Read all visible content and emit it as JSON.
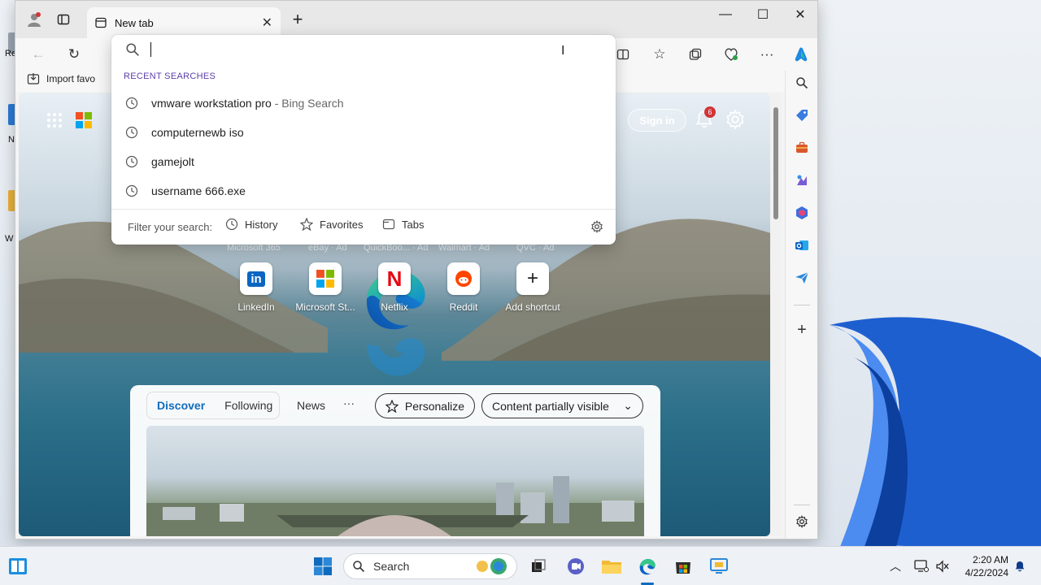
{
  "window": {
    "tab_title": "New tab",
    "close_tab": "✕",
    "new_tab": "+",
    "minimize": "—",
    "maximize": "☐",
    "close": "✕"
  },
  "favorites_bar": {
    "import_label": "Import favo"
  },
  "address_dropdown": {
    "input_value": "",
    "section_title": "RECENT SEARCHES",
    "recent": [
      {
        "query": "vmware workstation pro",
        "suffix": " - Bing Search"
      },
      {
        "query": "computernewb iso",
        "suffix": ""
      },
      {
        "query": "gamejolt",
        "suffix": ""
      },
      {
        "query": "username 666.exe",
        "suffix": ""
      }
    ],
    "filter_label": "Filter your search:",
    "filters": [
      "History",
      "Favorites",
      "Tabs"
    ]
  },
  "new_tab_page": {
    "sign_in": "Sign in",
    "notification_count": "6",
    "ad_sites": [
      "Microsoft 365",
      "eBay · Ad",
      "QuickBoo... · Ad",
      "Walmart · Ad",
      "QVC · Ad"
    ],
    "shortcuts": [
      {
        "label": "LinkedIn",
        "glyph": "in",
        "color": "#0a66c2"
      },
      {
        "label": "Microsoft St...",
        "glyph": "",
        "color": "#f25022"
      },
      {
        "label": "Netflix",
        "glyph": "N",
        "color": "#e50914"
      },
      {
        "label": "Reddit",
        "glyph": "●",
        "color": "#ff4500"
      },
      {
        "label": "Add shortcut",
        "glyph": "+",
        "color": "#222222"
      }
    ]
  },
  "feed": {
    "tabs": [
      "Discover",
      "Following"
    ],
    "news": "News",
    "more": "···",
    "personalize": "Personalize",
    "visibility": "Content partially visible"
  },
  "taskbar": {
    "search_label": "Search",
    "time": "2:20 AM",
    "date": "4/22/2024"
  },
  "desktop_labels": [
    "Re",
    "N",
    "W"
  ],
  "colors": {
    "accent": "#0f6cbd",
    "section_purple": "#5b3fa8",
    "badge_red": "#d13438"
  }
}
